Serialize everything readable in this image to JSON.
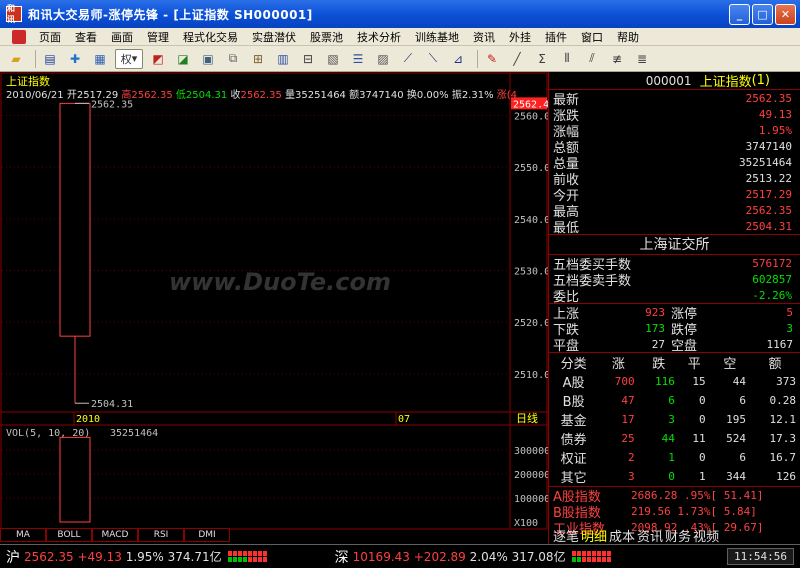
{
  "window": {
    "title": "和讯大交易师-涨停先锋 - [上证指数 SH000001]",
    "app_icon": "和讯",
    "minimize": "_",
    "maximize": "□",
    "close": "✕"
  },
  "menu": [
    "页面",
    "查看",
    "画面",
    "管理",
    "程式化交易",
    "实盘潜伏",
    "股票池",
    "技术分析",
    "训练基地",
    "资讯",
    "外挂",
    "插件",
    "窗口",
    "帮助"
  ],
  "toolbar": {
    "quan_label": "权"
  },
  "chart": {
    "name": "上证指数",
    "date": "2010/06/21",
    "open_label": "开",
    "open": "2517.29",
    "high_label": "高",
    "high": "2562.35",
    "low_label": "低",
    "low": "2504.31",
    "close_label": "收",
    "close": "2562.35",
    "vol_label": "量",
    "vol": "35251464",
    "amt_label": "额",
    "amt": "3747140",
    "turn_label": "换",
    "turn": "0.00%",
    "amp_label": "振",
    "amp": "2.31%",
    "chg_label": "涨",
    "chg": "(4",
    "high_marker": "2562.35",
    "low_marker": "2504.31",
    "current_tag": "2562.4",
    "price_ticks": [
      "2560.0",
      "2550.0",
      "2540.0",
      "2530.0",
      "2520.0",
      "2510.0"
    ],
    "date_labels": [
      "2010",
      "07"
    ],
    "axis_unit": "日线",
    "vol_header": "VOL(5, 10, 20)",
    "vol_value": "35251464",
    "vol_ticks": [
      "300000",
      "200000",
      "100000",
      "X100"
    ],
    "watermark": "www.DuoTe.com"
  },
  "chart_data": {
    "type": "candlestick",
    "date": "2010/06/21",
    "open": 2517.29,
    "high": 2562.35,
    "low": 2504.31,
    "close": 2562.35,
    "volume": 35251464,
    "price_axis": [
      2503,
      2563
    ],
    "volume_axis": [
      0,
      400000
    ]
  },
  "bottom_tabs": [
    "MA",
    "BOLL",
    "MACD",
    "RSI",
    "DMI"
  ],
  "quote": {
    "code": "000001",
    "name": "上证指数",
    "suffix": "(1)",
    "rows": [
      {
        "label": "最新",
        "value": "2562.35",
        "color": "#ff4040"
      },
      {
        "label": "涨跌",
        "value": "49.13",
        "color": "#ff4040"
      },
      {
        "label": "涨幅",
        "value": "1.95%",
        "color": "#ff4040"
      },
      {
        "label": "总额",
        "value": "3747140",
        "color": "#e0e0e0"
      },
      {
        "label": "总量",
        "value": "35251464",
        "color": "#e0e0e0"
      },
      {
        "label": "前收",
        "value": "2513.22",
        "color": "#e0e0e0"
      },
      {
        "label": "今开",
        "value": "2517.29",
        "color": "#ff4040"
      },
      {
        "label": "最高",
        "value": "2562.35",
        "color": "#ff4040"
      },
      {
        "label": "最低",
        "value": "2504.31",
        "color": "#ff4040"
      }
    ],
    "exchange": "上海证交所",
    "wudang": [
      {
        "label": "五档委买手数",
        "value": "576172",
        "color": "#ff4040"
      },
      {
        "label": "五档委卖手数",
        "value": "602857",
        "color": "#00e000"
      },
      {
        "label": "委比",
        "value": "-2.26%",
        "color": "#00e000"
      }
    ],
    "breadth": [
      {
        "l1": "上涨",
        "v1": "923",
        "l2": "涨停",
        "v2": "5",
        "c": "#ff4040"
      },
      {
        "l1": "下跌",
        "v1": "173",
        "l2": "跌停",
        "v2": "3",
        "c": "#00e000"
      },
      {
        "l1": "平盘",
        "v1": "27",
        "l2": "空盘",
        "v2": "1167",
        "c": "#e0e0e0"
      }
    ],
    "table_headers": [
      "分类",
      "涨",
      "跌",
      "平",
      "空",
      "额"
    ],
    "table_rows": [
      [
        "A股",
        "700",
        "116",
        "15",
        "44",
        "373"
      ],
      [
        "B股",
        "47",
        "6",
        "0",
        "6",
        "0.28"
      ],
      [
        "基金",
        "17",
        "3",
        "0",
        "195",
        "12.1"
      ],
      [
        "债券",
        "25",
        "44",
        "11",
        "524",
        "17.3"
      ],
      [
        "权证",
        "2",
        "1",
        "0",
        "6",
        "16.7"
      ],
      [
        "其它",
        "3",
        "0",
        "1",
        "344",
        "126"
      ]
    ],
    "indices": [
      {
        "name": "A股指数",
        "value": "2686.28 .95%[ 51.41]"
      },
      {
        "name": "B股指数",
        "value": "219.56 1.73%[ 5.84]"
      },
      {
        "name": "工业指数",
        "value": "2098.92 .43%[ 29.67]"
      }
    ],
    "tabs": [
      "逐笔",
      "明细",
      "成本",
      "资讯",
      "财务",
      "视频"
    ]
  },
  "status": {
    "sh_label": "沪",
    "sh_index": "2562.35",
    "sh_change": "+49.13",
    "sh_pct": "1.95%",
    "sh_amount": "374.71亿",
    "sz_label": "深",
    "sz_index": "10169.43",
    "sz_change": "+202.89",
    "sz_pct": "2.04%",
    "sz_amount": "317.08亿",
    "time": "11:54:56"
  }
}
